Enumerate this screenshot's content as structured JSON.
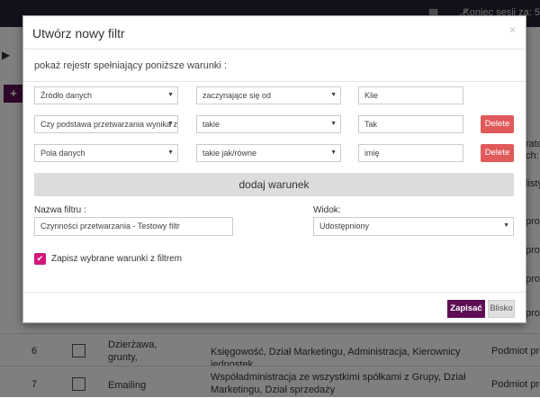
{
  "topbar": {
    "session_label": "Koniec sesji za: 5"
  },
  "background": {
    "side_texts": [
      "rato",
      "ch:",
      "listy",
      "prow",
      "prow",
      "prow",
      "prow",
      "prow"
    ],
    "rows": [
      {
        "num": "6",
        "name": "Dzierżawa, grunty, nieruchomości",
        "departments": "Księgowość, Dział Marketingu, Administracja, Kierownicy jednostek",
        "legal": "Podmiot prow"
      },
      {
        "num": "7",
        "name": "Emailing",
        "departments": "Współadministracja ze wszystkimi spółkami z Grupy, Dział Marketingu, Dział sprzedaży",
        "legal": "Podmiot prow"
      }
    ]
  },
  "modal": {
    "title": "Utwórz nowy filtr",
    "close_label": "×",
    "intro": "pokaż rejestr spełniający poniższe warunki :",
    "conditions": [
      {
        "field": "Źródło danych",
        "operator": "zaczynające się od",
        "value": "Klie",
        "delete_label": ""
      },
      {
        "field": "Czy podstawa przetwarzania wynika z",
        "operator": "takie",
        "value": "Tak",
        "delete_label": "Delete"
      },
      {
        "field": "Pola danych",
        "operator": "takie jak/równe",
        "value": "imię",
        "delete_label": "Delete"
      }
    ],
    "add_condition_label": "dodaj warunek",
    "filter_name_label": "Nazwa filtru :",
    "filter_name_value": "Czynności przetwarzania - Testowy filtr",
    "view_label": "Widok:",
    "view_value": "Udostępniony",
    "save_checkbox_label": "Zapisz wybrane warunki z filtrem",
    "save_button": "Zapisać",
    "close_button": "Blisko"
  }
}
